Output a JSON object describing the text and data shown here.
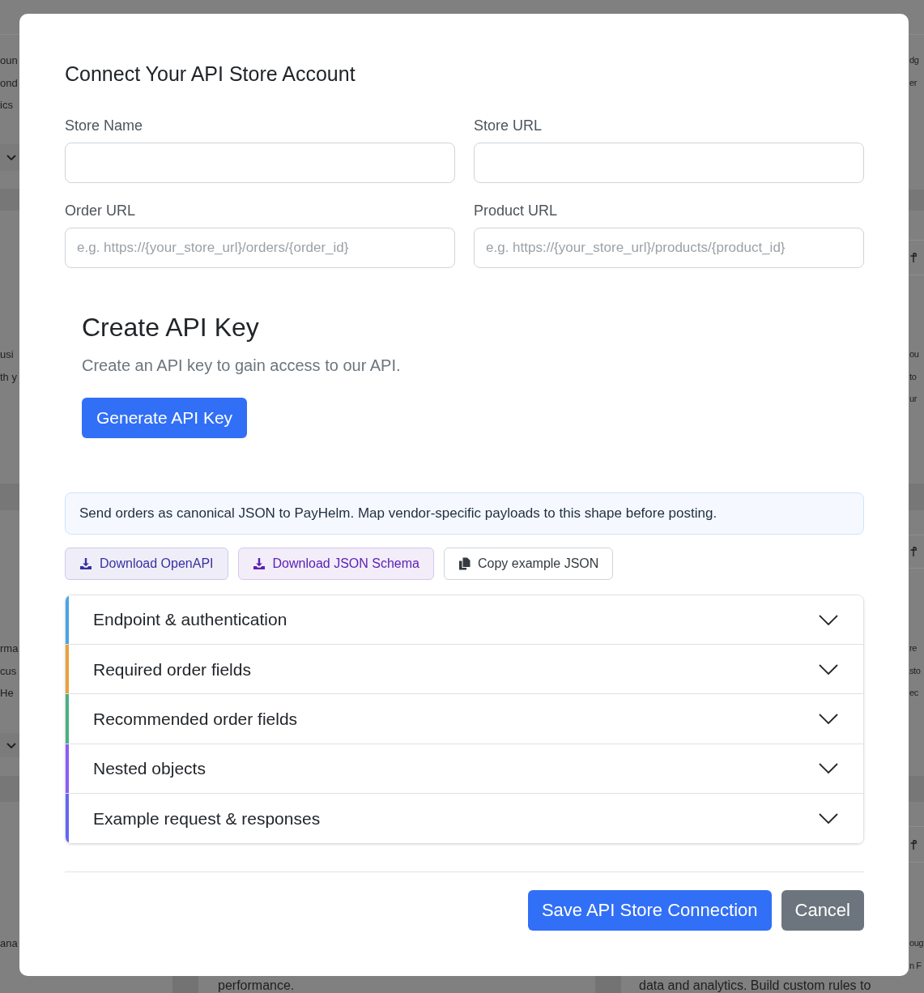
{
  "background": {
    "left_cards": [
      {
        "lines": [
          "oun",
          "ond",
          "ics"
        ]
      },
      {
        "lines": [
          "usi",
          "th y"
        ]
      },
      {
        "lines": [
          "rma",
          "cus",
          "He"
        ]
      },
      {
        "lines": [
          "ana"
        ]
      }
    ],
    "right_cards": [
      {
        "lines": [
          "dg",
          "er"
        ]
      },
      {
        "lines": [
          "ou",
          "to",
          "ur"
        ]
      },
      {
        "lines": [
          "re",
          "sto",
          "ec"
        ]
      },
      {
        "lines": [
          "oug",
          "n F"
        ]
      }
    ],
    "bottom_texts": [
      "performance.",
      "data and analytics. Build custom rules to"
    ]
  },
  "dialog": {
    "title": "Connect Your API Store Account",
    "fields": [
      {
        "label": "Store Name"
      },
      {
        "label": "Store URL"
      },
      {
        "label": "Order URL",
        "placeholder": "e.g. https://{your_store_url}/orders/{order_id}"
      },
      {
        "label": "Product URL",
        "placeholder": "e.g. https://{your_store_url}/products/{product_id}"
      }
    ],
    "api_key": {
      "title": "Create API Key",
      "description": "Create an API key to gain access to our API.",
      "button": "Generate API Key"
    },
    "info": "Send orders as canonical JSON to PayHelm. Map vendor-specific payloads to this shape before posting.",
    "doc_buttons": [
      {
        "label": "Download OpenAPI",
        "kind": "download",
        "color": "#3730a3"
      },
      {
        "label": "Download JSON Schema",
        "kind": "download",
        "color": "#5b21b6"
      },
      {
        "label": "Copy example JSON",
        "kind": "copy"
      }
    ],
    "sections": [
      {
        "title": "Endpoint & authentication",
        "color": "#4ba3e3",
        "expanded": false
      },
      {
        "title": "Required order fields",
        "color": "#e9a23b",
        "expanded": false
      },
      {
        "title": "Recommended order fields",
        "color": "#4caf82",
        "expanded": false
      },
      {
        "title": "Nested objects",
        "color": "#8b5cf6",
        "expanded": false
      },
      {
        "title": "Example request & responses",
        "color": "#6366f1",
        "expanded": false
      }
    ],
    "footer_buttons": [
      {
        "label": "Save API Store Connection",
        "kind": "primary"
      },
      {
        "label": "Cancel",
        "kind": "secondary"
      }
    ]
  }
}
